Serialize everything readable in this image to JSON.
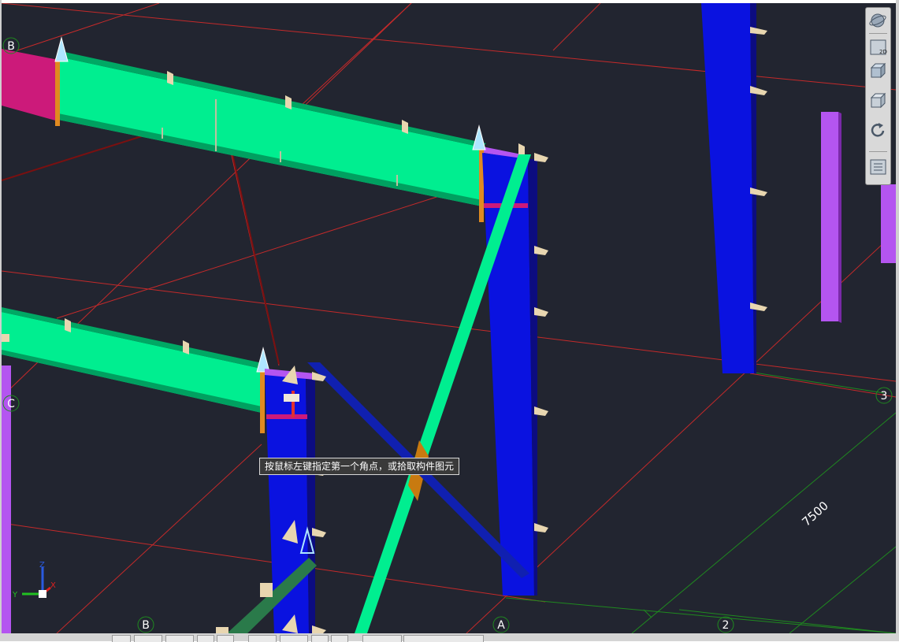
{
  "viewport": {
    "command_prompt": "按鼠标左键指定第一个角点，或拾取构件图元",
    "dimension_label": "7500",
    "grid_axes": {
      "letters": [
        "B",
        "A"
      ],
      "numbers": [
        "2",
        "3"
      ],
      "partial_letters": [
        "B",
        "C"
      ]
    }
  },
  "viewcube": {
    "icons": [
      "orbit-icon",
      "2d-view-icon",
      "3d-box-view-icon",
      "box-view-icon",
      "rotate-view-icon",
      "properties-panel-icon"
    ],
    "label_2d": "2D"
  },
  "ucs": {
    "x": "X",
    "y": "Y",
    "z": "Z"
  },
  "colors": {
    "background": "#222530",
    "grid_red": "#c42a2a",
    "grid_green": "#1f8a1f",
    "rafter_green": "#00ee90",
    "column_blue": "#0a12e0",
    "brace_dark_blue": "#1020b0",
    "rafter_magenta": "#cc1a7a",
    "purslin_purple": "#b455f0"
  }
}
